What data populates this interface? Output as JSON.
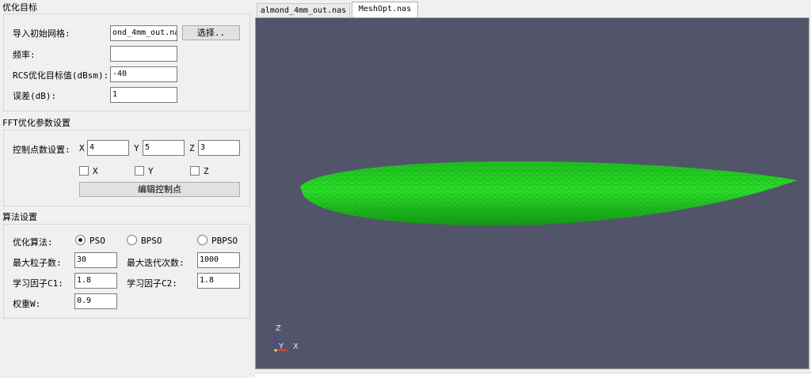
{
  "optimization_target": {
    "title": "优化目标",
    "import_mesh_label": "导入初始网格:",
    "import_mesh_value": "ond_4mm_out.nas",
    "select_button": "选择..",
    "frequency_label": "频率:",
    "frequency_value": "",
    "rcs_target_label": "RCS优化目标值(dBsm):",
    "rcs_target_value": "-40",
    "error_label": "误差(dB):",
    "error_value": "1"
  },
  "fft_params": {
    "title": "FFT优化参数设置",
    "control_points_label": "控制点数设置:",
    "x_label": "X",
    "x_value": "4",
    "y_label": "Y",
    "y_value": "5",
    "z_label": "Z",
    "z_value": "3",
    "check_x_label": "X",
    "check_y_label": "Y",
    "check_z_label": "Z",
    "edit_button": "编辑控制点"
  },
  "algorithm": {
    "title": "算法设置",
    "algo_label": "优化算法:",
    "options": [
      "PSO",
      "BPSO",
      "PBPSO"
    ],
    "selected": "PSO",
    "max_particles_label": "最大粒子数:",
    "max_particles_value": "30",
    "max_iter_label": "最大迭代次数:",
    "max_iter_value": "1000",
    "c1_label": "学习因子C1:",
    "c1_value": "1.8",
    "c2_label": "学习因子C2:",
    "c2_value": "1.8",
    "w_label": "权重W:",
    "w_value": "0.9"
  },
  "tabs": [
    {
      "label": "almond_4mm_out.nas",
      "active": false
    },
    {
      "label": "MeshOpt.nas",
      "active": true
    }
  ],
  "viewport": {
    "background": "#525469",
    "mesh_color": "#22cc22",
    "axes": {
      "z": "Z",
      "y": "Y",
      "x": "X"
    }
  }
}
